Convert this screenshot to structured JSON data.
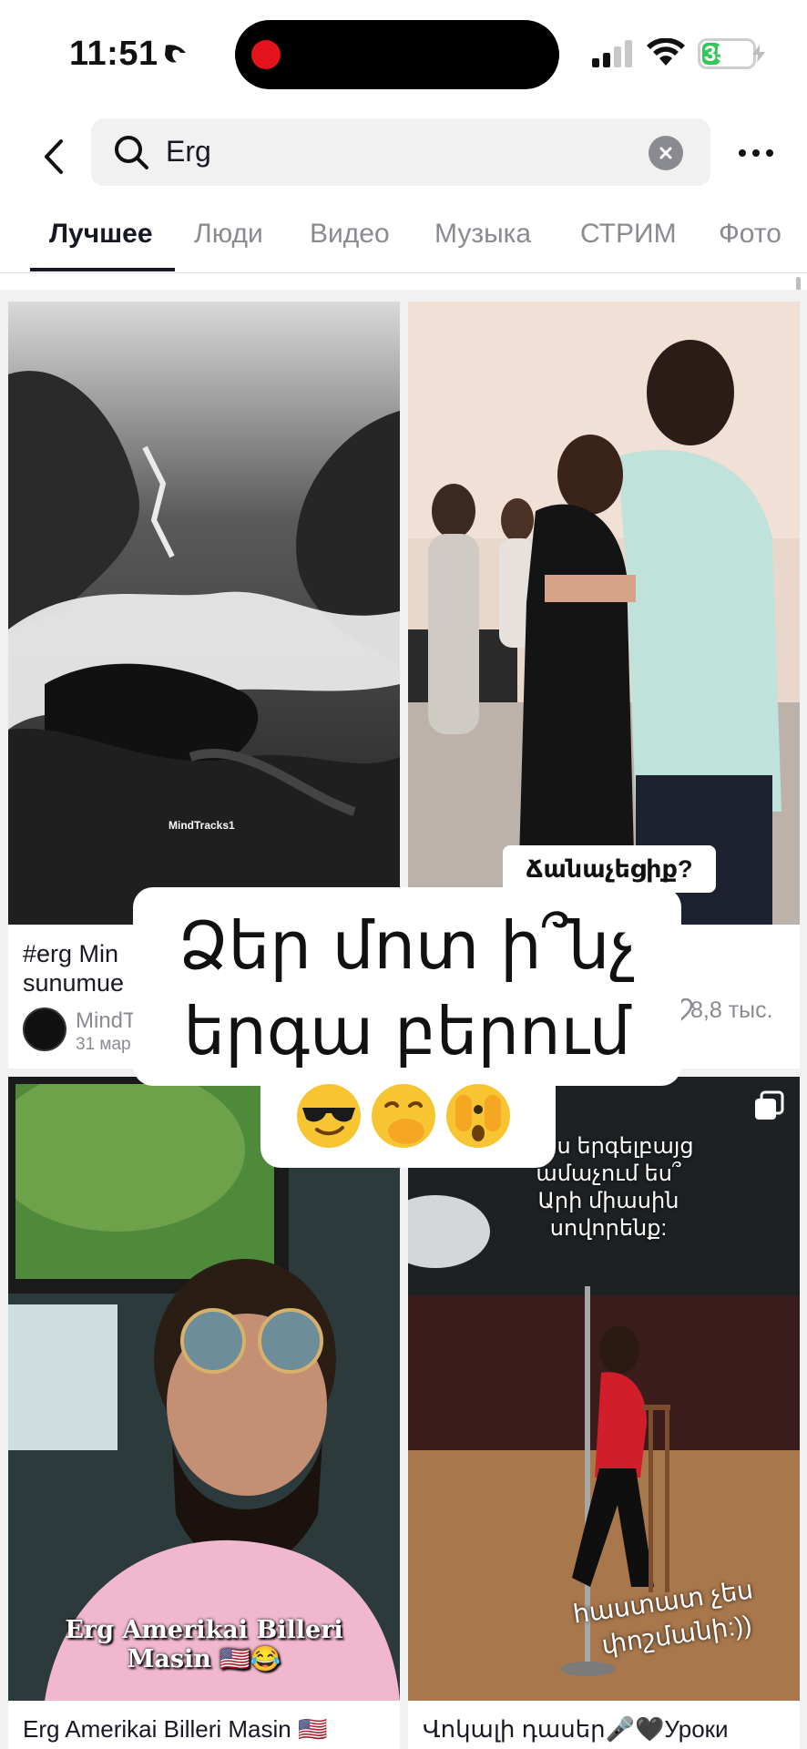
{
  "status_bar": {
    "time": "11:51",
    "battery": "35"
  },
  "search": {
    "query": "Erg"
  },
  "tabs": [
    {
      "label": "Лучшее",
      "active": true
    },
    {
      "label": "Люди"
    },
    {
      "label": "Видео"
    },
    {
      "label": "Музыка"
    },
    {
      "label": "СТРИМ"
    },
    {
      "label": "Фото"
    }
  ],
  "cards": [
    {
      "title_1": "#erg Min",
      "title_2": "sunumue",
      "author": "MindT",
      "date": "31 мар",
      "thumb_tag": "MindTracks1"
    },
    {
      "sticker": "Ճանաչեցիք?",
      "likes": "8,8 тыс."
    },
    {
      "overlay_1": "Erg Amerikai Billeri",
      "overlay_2": "Masin 🇺🇸😂",
      "title": "Erg Amerikai Billeri Masin 🇺🇸"
    },
    {
      "top_1": "մ ես երգելբայց",
      "top_2": "ամաչում ես՞",
      "top_3": "Արի միասին",
      "top_4": "սովորենք:",
      "bottom_1": "հաստատ չես",
      "bottom_2": "փոշմանի:))",
      "title": "Վոկալի դասեր🎤🖤Уроки"
    }
  ],
  "text_overlay": {
    "line_1": "Ձեր մոտ ի՞նչ",
    "line_2": "երգա բերում"
  }
}
